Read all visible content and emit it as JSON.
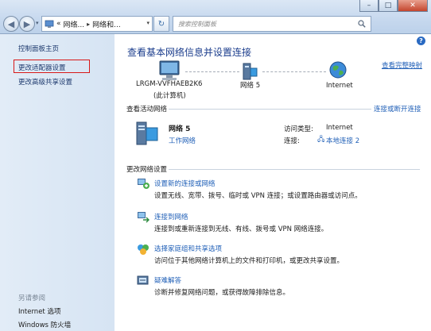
{
  "address_bar": {
    "breadcrumb": [
      "«",
      "网络...",
      "网络和..."
    ],
    "dropdown": "▾"
  },
  "search": {
    "placeholder": "搜索控制面板"
  },
  "window_controls": {
    "minimize": "–",
    "maximize": "□",
    "close": "✕"
  },
  "sidebar": {
    "home": "控制面板主页",
    "change_adapter": "更改适配器设置",
    "advanced_sharing": "更改高级共享设置",
    "see_also_label": "另请参阅",
    "see_also": [
      "Internet 选项",
      "Windows 防火墙"
    ]
  },
  "main": {
    "title": "查看基本网络信息并设置连接",
    "full_map_link": "查看完整映射",
    "map_nodes": {
      "computer_name": "LRGM-VVFHAEB2K6",
      "computer_sub": "(此计算机)",
      "network": "网络  5",
      "internet": "Internet"
    },
    "active_networks": {
      "heading": "查看活动网络",
      "connect_link": "连接或断开连接",
      "name": "网络  5",
      "type": "工作网络",
      "access_type_label": "访问类型:",
      "access_type_value": "Internet",
      "connections_label": "连接:",
      "connection_link": "本地连接 2"
    },
    "change_settings": {
      "heading": "更改网络设置",
      "tasks": [
        {
          "title": "设置新的连接或网络",
          "desc": "设置无线、宽带、拨号、临时或 VPN 连接；或设置路由器或访问点。"
        },
        {
          "title": "连接到网络",
          "desc": "连接到或重新连接到无线、有线、拨号或 VPN 网络连接。"
        },
        {
          "title": "选择家庭组和共享选项",
          "desc": "访问位于其他网络计算机上的文件和打印机，或更改共享设置。"
        },
        {
          "title": "疑难解答",
          "desc": "诊断并修复网络问题，或获得故障排除信息。"
        }
      ]
    }
  },
  "colors": {
    "link": "#1f5fb7",
    "title": "#1a3c8c",
    "highlight": "#d81818",
    "sidebar": "#dde8f5"
  }
}
